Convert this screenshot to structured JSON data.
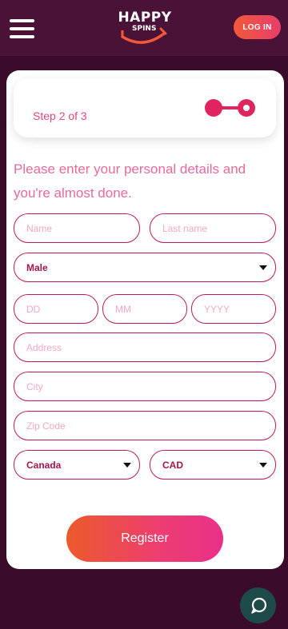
{
  "header": {
    "logo_top": "HAPPY",
    "logo_bottom": "SPINS",
    "login_label": "LOG IN"
  },
  "form": {
    "step_label": "Step 2 of 3",
    "heading": "Please enter your personal details and you're almost done.",
    "first_name_placeholder": "Name",
    "last_name_placeholder": "Last name",
    "gender_value": "Male",
    "day_placeholder": "DD",
    "month_placeholder": "MM",
    "year_placeholder": "YYYY",
    "address_placeholder": "Address",
    "city_placeholder": "City",
    "zip_placeholder": "Zip Code",
    "country_value": "Canada",
    "currency_value": "CAD",
    "register_label": "Register"
  },
  "colors": {
    "background": "#3a0c29",
    "header": "#4a1236",
    "accent_pink": "#e0497d",
    "field_border": "#c2185b",
    "chat_button": "#1f4a4a"
  },
  "icons": {
    "menu": "hamburger-icon",
    "step": "step-progress-icon",
    "dropdown": "caret-down-icon",
    "chat": "chat-bubble-icon"
  }
}
